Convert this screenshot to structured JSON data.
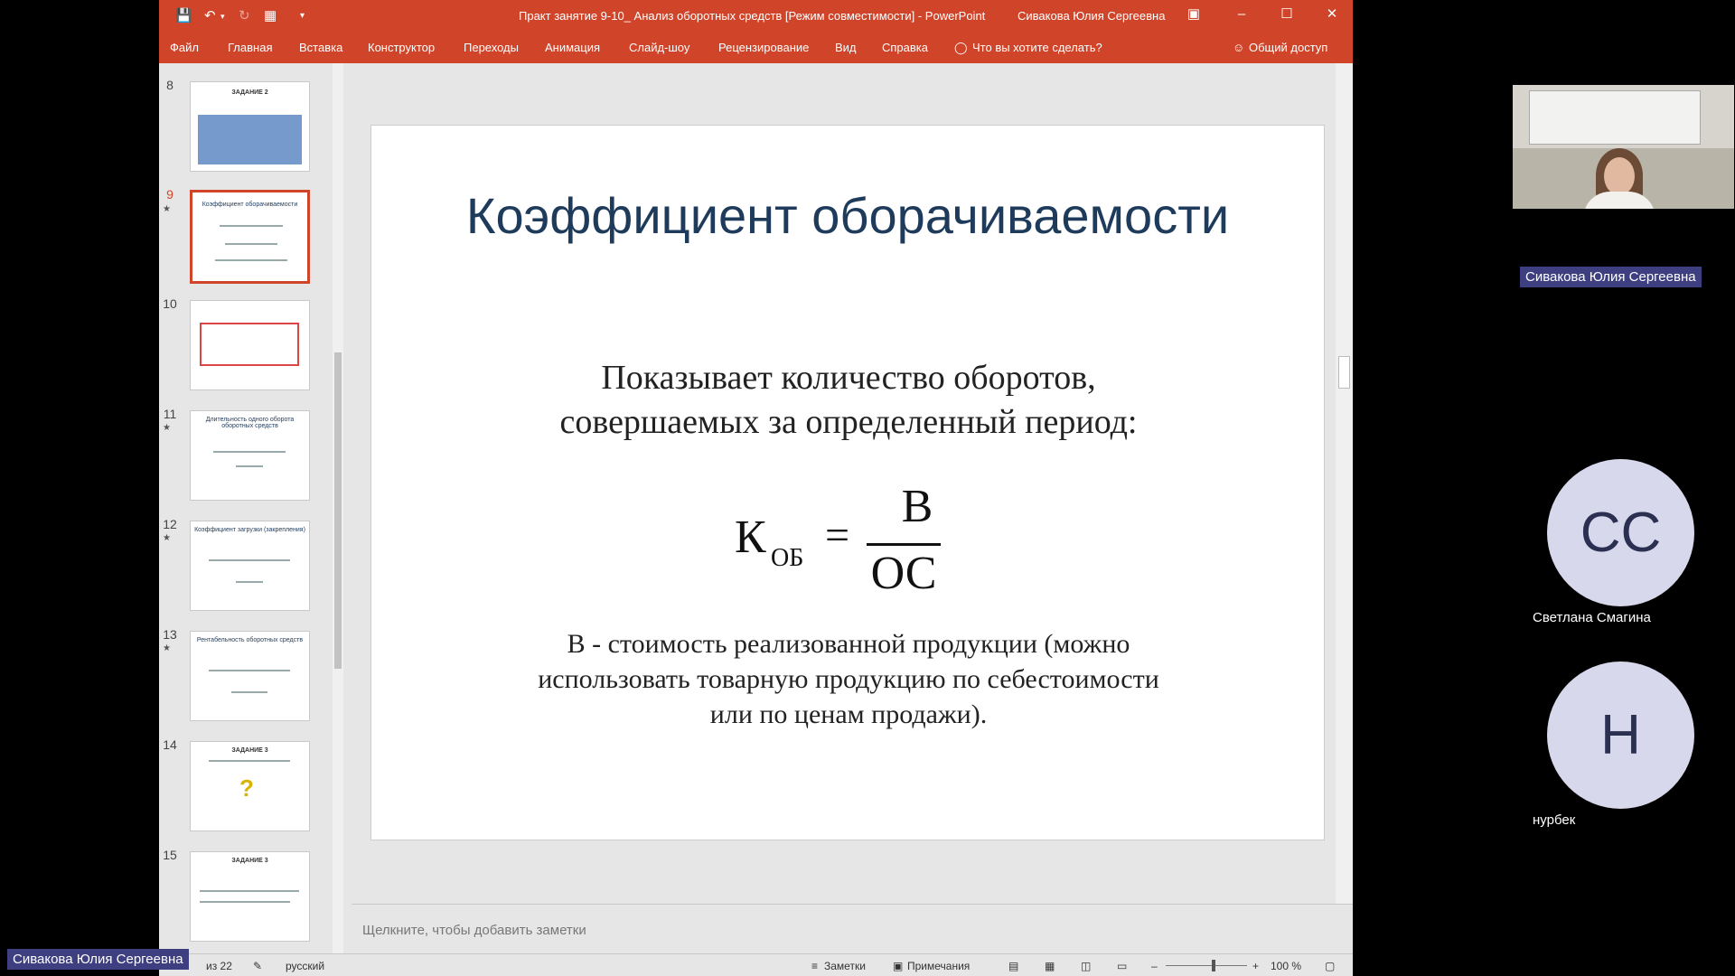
{
  "window": {
    "title": "Практ занятие 9-10_ Анализ оборотных средств [Режим совместимости]  -  PowerPoint",
    "user": "Сивакова Юлия Сергеевна"
  },
  "menu": [
    "Файл",
    "Главная",
    "Вставка",
    "Конструктор",
    "Переходы",
    "Анимация",
    "Слайд-шоу",
    "Рецензирование",
    "Вид",
    "Справка"
  ],
  "tell_me": "Что вы хотите сделать?",
  "share": "Общий доступ",
  "thumbnails": [
    {
      "num": "8",
      "star": false,
      "title": "ЗАДАНИЕ 2"
    },
    {
      "num": "9",
      "star": true,
      "title": "Коэффициент оборачиваемости",
      "active": true
    },
    {
      "num": "10",
      "star": false,
      "title": ""
    },
    {
      "num": "11",
      "star": true,
      "title": "Длительность одного оборота оборотных средств"
    },
    {
      "num": "12",
      "star": true,
      "title": "Коэффициент загрузки (закрепления)"
    },
    {
      "num": "13",
      "star": true,
      "title": "Рентабельность оборотных средств"
    },
    {
      "num": "14",
      "star": false,
      "title": "ЗАДАНИЕ 3"
    },
    {
      "num": "15",
      "star": false,
      "title": "ЗАДАНИЕ 3"
    }
  ],
  "slide": {
    "title": "Коэффициент оборачиваемости",
    "description_line1": "Показывает количество оборотов,",
    "description_line2": "совершаемых за определенный период:",
    "formula": {
      "k": "К",
      "k_sub": "ОБ",
      "eq": "=",
      "numerator": "В",
      "denominator": "ОС"
    },
    "note_line1": "В - стоимость реализованной продукции (можно",
    "note_line2": "использовать товарную продукцию по себестоимости",
    "note_line3": "или по ценам продажи)."
  },
  "notes_placeholder": "Щелкните, чтобы добавить заметки",
  "status": {
    "slide_of": "из 22",
    "language": "русский",
    "notes": "Заметки",
    "comments": "Примечания",
    "zoom": "100 %"
  },
  "participants": {
    "presenter_tag": "Сивакова Юлия Сергеевна",
    "video_tag": "Сивакова Юлия Сергеевна",
    "people": [
      {
        "initials": "СС",
        "name": "Светлана Смагина"
      },
      {
        "initials": "Н",
        "name": "нурбек"
      }
    ]
  },
  "colors": {
    "ppt_accent": "#d0452a",
    "title_blue": "#1f3b5c",
    "tag_bg": "#3d3f80"
  }
}
